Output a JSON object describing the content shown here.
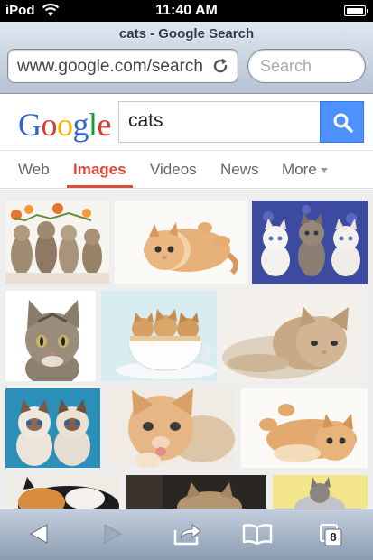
{
  "status_bar": {
    "carrier": "iPod",
    "time": "11:40 AM"
  },
  "browser": {
    "page_title": "cats - Google Search",
    "url": "www.google.com/search",
    "search_placeholder": "Search",
    "tab_count": "8"
  },
  "google": {
    "query": "cats",
    "logo": {
      "l1": "G",
      "l2": "o",
      "l3": "o",
      "l4": "g",
      "l5": "l",
      "l6": "e"
    }
  },
  "tabs": [
    {
      "label": "Web",
      "active": false
    },
    {
      "label": "Images",
      "active": true
    },
    {
      "label": "Videos",
      "active": false
    },
    {
      "label": "News",
      "active": false
    },
    {
      "label": "More",
      "active": false
    }
  ],
  "colors": {
    "active_tab": "#dd4b39",
    "search_button": "#4d90fe",
    "logo_blue": "#3366cc",
    "logo_red": "#dd3b2f",
    "logo_yellow": "#f0b400",
    "logo_green": "#159a37"
  },
  "icons": {
    "wifi": "wifi-icon",
    "battery": "battery-icon",
    "reload": "reload-icon",
    "search": "magnifier-icon",
    "back": "back-arrow-icon",
    "forward": "forward-arrow-icon",
    "share": "share-icon",
    "bookmarks": "open-book-icon",
    "tabs": "pages-icon"
  },
  "image_results": [
    {
      "subject": "row of tabby kittens with flowers"
    },
    {
      "subject": "orange kitten lying on back"
    },
    {
      "subject": "three kittens on blue blanket"
    },
    {
      "subject": "tabby kitten portrait"
    },
    {
      "subject": "three kittens in a teacup"
    },
    {
      "subject": "tabby kitten resting"
    },
    {
      "subject": "two fluffy kittens on blue"
    },
    {
      "subject": "orange kitten licking paw"
    },
    {
      "subject": "orange kitten lying on back"
    },
    {
      "subject": "calico cat"
    },
    {
      "subject": "kitten on dark background"
    },
    {
      "subject": "kitten on yellow background"
    }
  ]
}
